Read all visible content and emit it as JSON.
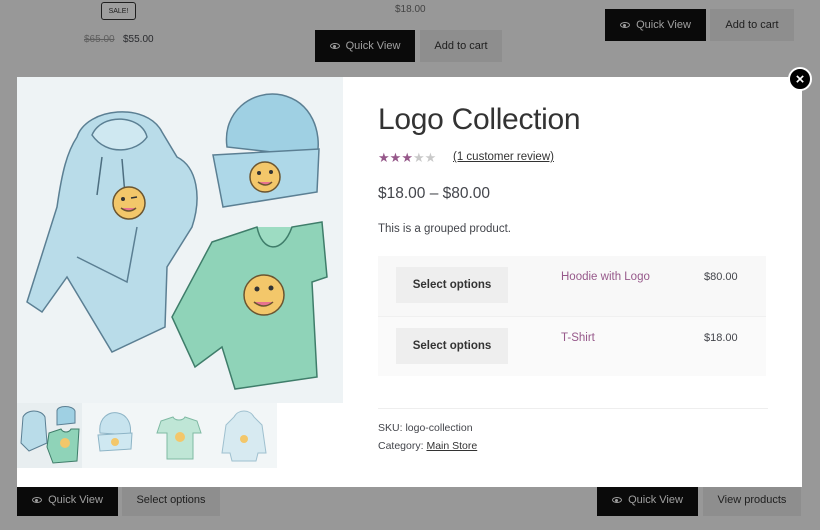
{
  "background": {
    "sale_badge": "SALE!",
    "old_price": "$65.00",
    "sale_price": "$55.00",
    "top_price": "$18.00",
    "quick_view_label": "Quick View",
    "add_to_cart_label": "Add to cart",
    "select_options_label": "Select options",
    "view_products_label": "View products"
  },
  "modal": {
    "close_symbol": "×",
    "title": "Logo Collection",
    "rating": {
      "stars_filled": 3,
      "stars_total": 5
    },
    "review_link": "(1 customer review)",
    "price_range": "$18.00 – $80.00",
    "description": "This is a grouped product.",
    "grouped_items": [
      {
        "button": "Select options",
        "name": "Hoodie with Logo",
        "price": "$80.00"
      },
      {
        "button": "Select options",
        "name": "T-Shirt",
        "price": "$18.00"
      }
    ],
    "sku_label": "SKU:",
    "sku_value": "logo-collection",
    "category_label": "Category:",
    "category_value": "Main Store",
    "thumbnails": [
      "logo-collection-thumb",
      "beanie-thumb",
      "tshirt-thumb",
      "hoodie-thumb"
    ]
  },
  "colors": {
    "accent": "#96588a",
    "dark_button": "#111111",
    "overlay": "rgba(0,0,0,0.38)"
  }
}
